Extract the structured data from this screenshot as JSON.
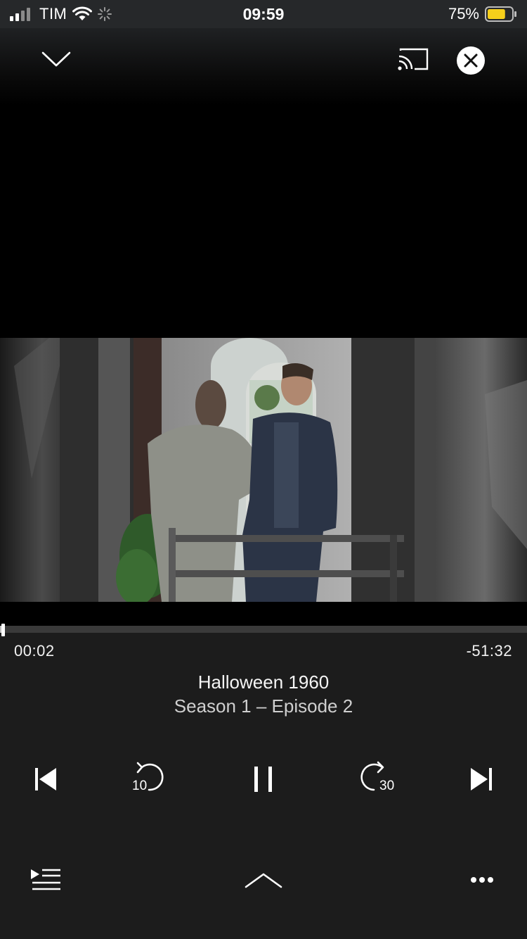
{
  "status_bar": {
    "carrier": "TIM",
    "time": "09:59",
    "battery_percent": "75%",
    "battery_level": 0.75,
    "battery_color": "#f5cf1b"
  },
  "top_bar": {
    "icons": [
      "chevron-down-icon",
      "cast-icon",
      "close-icon"
    ]
  },
  "player": {
    "elapsed": "00:02",
    "remaining": "-51:32",
    "progress_fraction": 0.005,
    "title": "Halloween 1960",
    "subtitle": "Season 1 – Episode 2"
  },
  "controls": {
    "rewind_seconds": "10",
    "forward_seconds": "30",
    "icons": [
      "skip-previous-icon",
      "rewind-10-icon",
      "pause-icon",
      "forward-30-icon",
      "skip-next-icon"
    ]
  },
  "bottom_bar": {
    "icons": [
      "queue-list-icon",
      "chevron-up-icon",
      "more-icon"
    ]
  }
}
